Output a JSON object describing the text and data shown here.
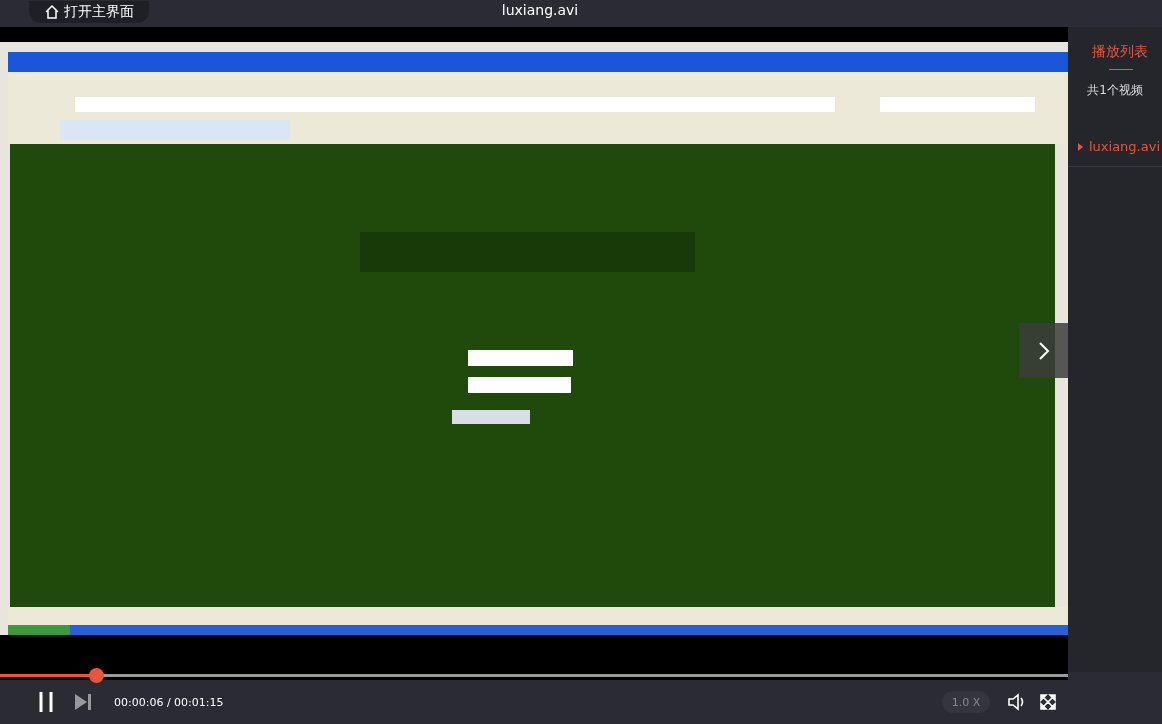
{
  "top_bar": {
    "home_button": "打开主界面",
    "title": "luxiang.avi"
  },
  "playlist": {
    "title": "播放列表",
    "count": "共1个视频",
    "items": [
      {
        "label": "luxiang.avi",
        "selected": true
      }
    ]
  },
  "controls": {
    "progress": {
      "level": 0.09
    },
    "time": "00:00:06 / 00:01:15",
    "speed": "1.0 X",
    "playing": true
  }
}
